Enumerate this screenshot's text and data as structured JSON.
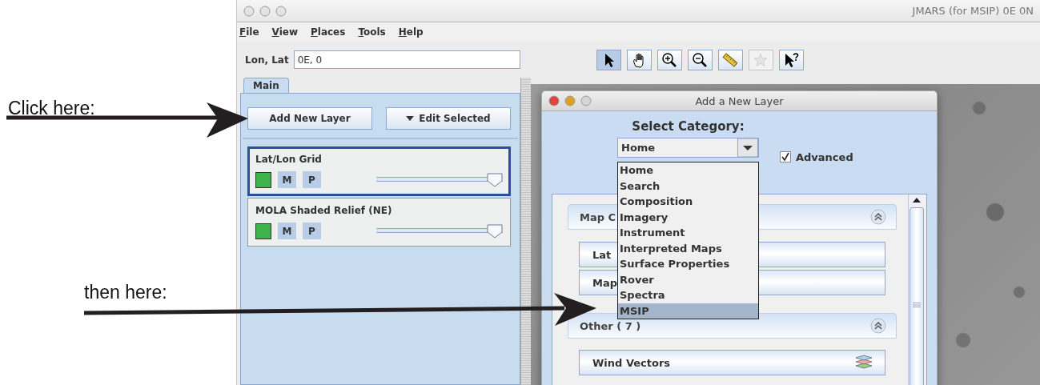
{
  "annotations": [
    {
      "text": "Click here:"
    },
    {
      "text": "then here:"
    }
  ],
  "window": {
    "title": "JMARS (for MSIP) 0E 0N"
  },
  "menu": [
    "File",
    "View",
    "Places",
    "Tools",
    "Help"
  ],
  "location": {
    "label": "Lon, Lat",
    "value": "0E, 0"
  },
  "toolbar": [
    {
      "kind": "pointer",
      "selected": true,
      "disabled": false
    },
    {
      "kind": "pan",
      "selected": false,
      "disabled": false
    },
    {
      "kind": "zoom-in",
      "selected": false,
      "disabled": false
    },
    {
      "kind": "zoom-out",
      "selected": false,
      "disabled": false
    },
    {
      "kind": "ruler",
      "selected": false,
      "disabled": false
    },
    {
      "kind": "star",
      "selected": false,
      "disabled": true
    },
    {
      "kind": "help-pointer",
      "selected": false,
      "disabled": false
    }
  ],
  "tabs": [
    {
      "label": "Main",
      "selected": true
    }
  ],
  "layer_buttons": [
    {
      "label": "Add New Layer",
      "kind": "plain"
    },
    {
      "label": "Edit Selected",
      "kind": "menu"
    }
  ],
  "layers": [
    {
      "name": "Lat/Lon Grid",
      "selected": true,
      "color": "#3db34a",
      "buttons": [
        "M",
        "P"
      ],
      "level": 1
    },
    {
      "name": "MOLA Shaded Relief (NE)",
      "selected": false,
      "color": "#3db34a",
      "buttons": [
        "M",
        "P"
      ],
      "level": 1
    }
  ],
  "dialog": {
    "title": "Add a New Layer",
    "category_label": "Select Category:",
    "category": "Home",
    "advanced": {
      "label": "Advanced",
      "checked": true
    },
    "options": [
      {
        "label": "Home",
        "selected": false
      },
      {
        "label": "Search",
        "selected": false
      },
      {
        "label": "Composition",
        "selected": false
      },
      {
        "label": "Imagery",
        "selected": false
      },
      {
        "label": "Instrument",
        "selected": false
      },
      {
        "label": "Interpreted Maps",
        "selected": false
      },
      {
        "label": "Surface Properties",
        "selected": false
      },
      {
        "label": "Rover",
        "selected": false
      },
      {
        "label": "Spectra",
        "selected": false
      },
      {
        "label": "MSIP",
        "selected": true
      }
    ],
    "sections": [
      {
        "title": "Map C",
        "expanded": true,
        "items": [
          {
            "label": "Lat",
            "icon": false
          },
          {
            "label": "Map",
            "icon": false
          }
        ]
      },
      {
        "title": "Other ( 7 )",
        "expanded": true,
        "items": [
          {
            "label": "Wind Vectors",
            "icon": true
          }
        ]
      }
    ]
  }
}
